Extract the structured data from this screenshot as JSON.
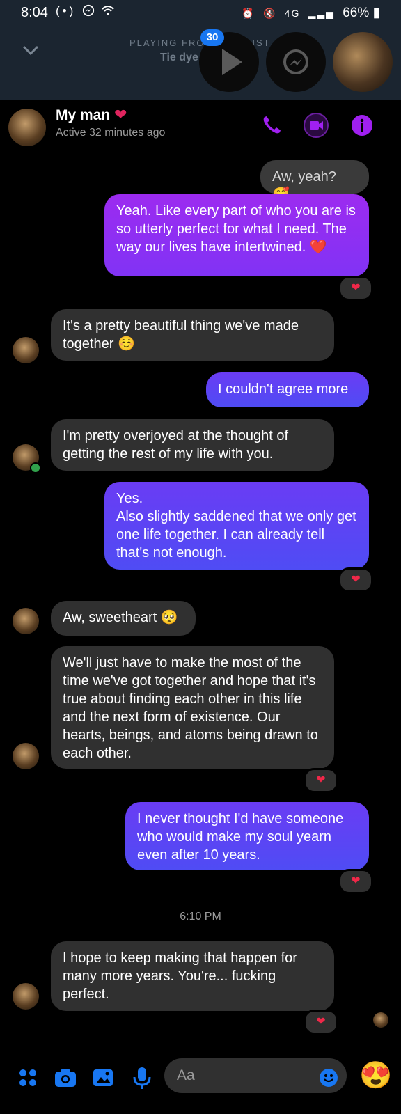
{
  "status_bar": {
    "time": "8:04",
    "left_icons": [
      "broadcast-icon",
      "messenger-icon",
      "wifi-icon"
    ],
    "network": "4G",
    "battery": "66%"
  },
  "mini_player": {
    "label": "PLAYING FROM PLAYLIST",
    "track": "Tie dye",
    "badge_count": "30"
  },
  "chat_header": {
    "name": "My man",
    "status": "Active 32 minutes ago",
    "actions": [
      "call",
      "video",
      "info"
    ],
    "accent_color": "#a020f0"
  },
  "messages": [
    {
      "direction": "out",
      "text": "Aw, yeah? 🥰",
      "reaction": ""
    },
    {
      "direction": "out",
      "text": "Yeah. Like every part of who you are is so utterly perfect for what I need. The way our lives have intertwined. ❤️",
      "reaction": "❤"
    },
    {
      "direction": "in",
      "text": "It's a pretty beautiful thing we've made together ☺️",
      "reaction": ""
    },
    {
      "direction": "out",
      "text": "I couldn't agree more",
      "reaction": ""
    },
    {
      "direction": "in",
      "text": "I'm pretty overjoyed at the thought of getting the rest of my life with you.",
      "reaction": ""
    },
    {
      "direction": "out",
      "text": "Yes.\nAlso slightly saddened that we only get one life together. I can already tell that's not enough.",
      "reaction": "❤"
    },
    {
      "direction": "in",
      "text": "Aw, sweetheart 🥺",
      "reaction": ""
    },
    {
      "direction": "in",
      "text": "We'll just have to make the most of the time we've got together and hope that it's true about finding each other in this life and the next form of existence. Our hearts, beings, and atoms being drawn to each other.",
      "reaction": "❤"
    },
    {
      "direction": "out",
      "text": "I never thought I'd have someone who would make my soul yearn even after 10 years.",
      "reaction": "❤"
    },
    {
      "direction": "in",
      "text": "I hope to keep making that happen for many more years. You're... fucking perfect.",
      "reaction": "❤"
    }
  ],
  "timestamp": "6:10 PM",
  "composer": {
    "placeholder": "Aa",
    "icons": [
      "apps-icon",
      "camera-icon",
      "gallery-icon",
      "mic-icon",
      "emoji-icon"
    ],
    "quick_reaction": "😍"
  },
  "colors": {
    "incoming_bubble": "#303030",
    "outgoing_purple": "#9c2bf0",
    "outgoing_blue": "#5348f4",
    "reaction_heart": "#f02849",
    "composer_icon": "#1877f2"
  }
}
